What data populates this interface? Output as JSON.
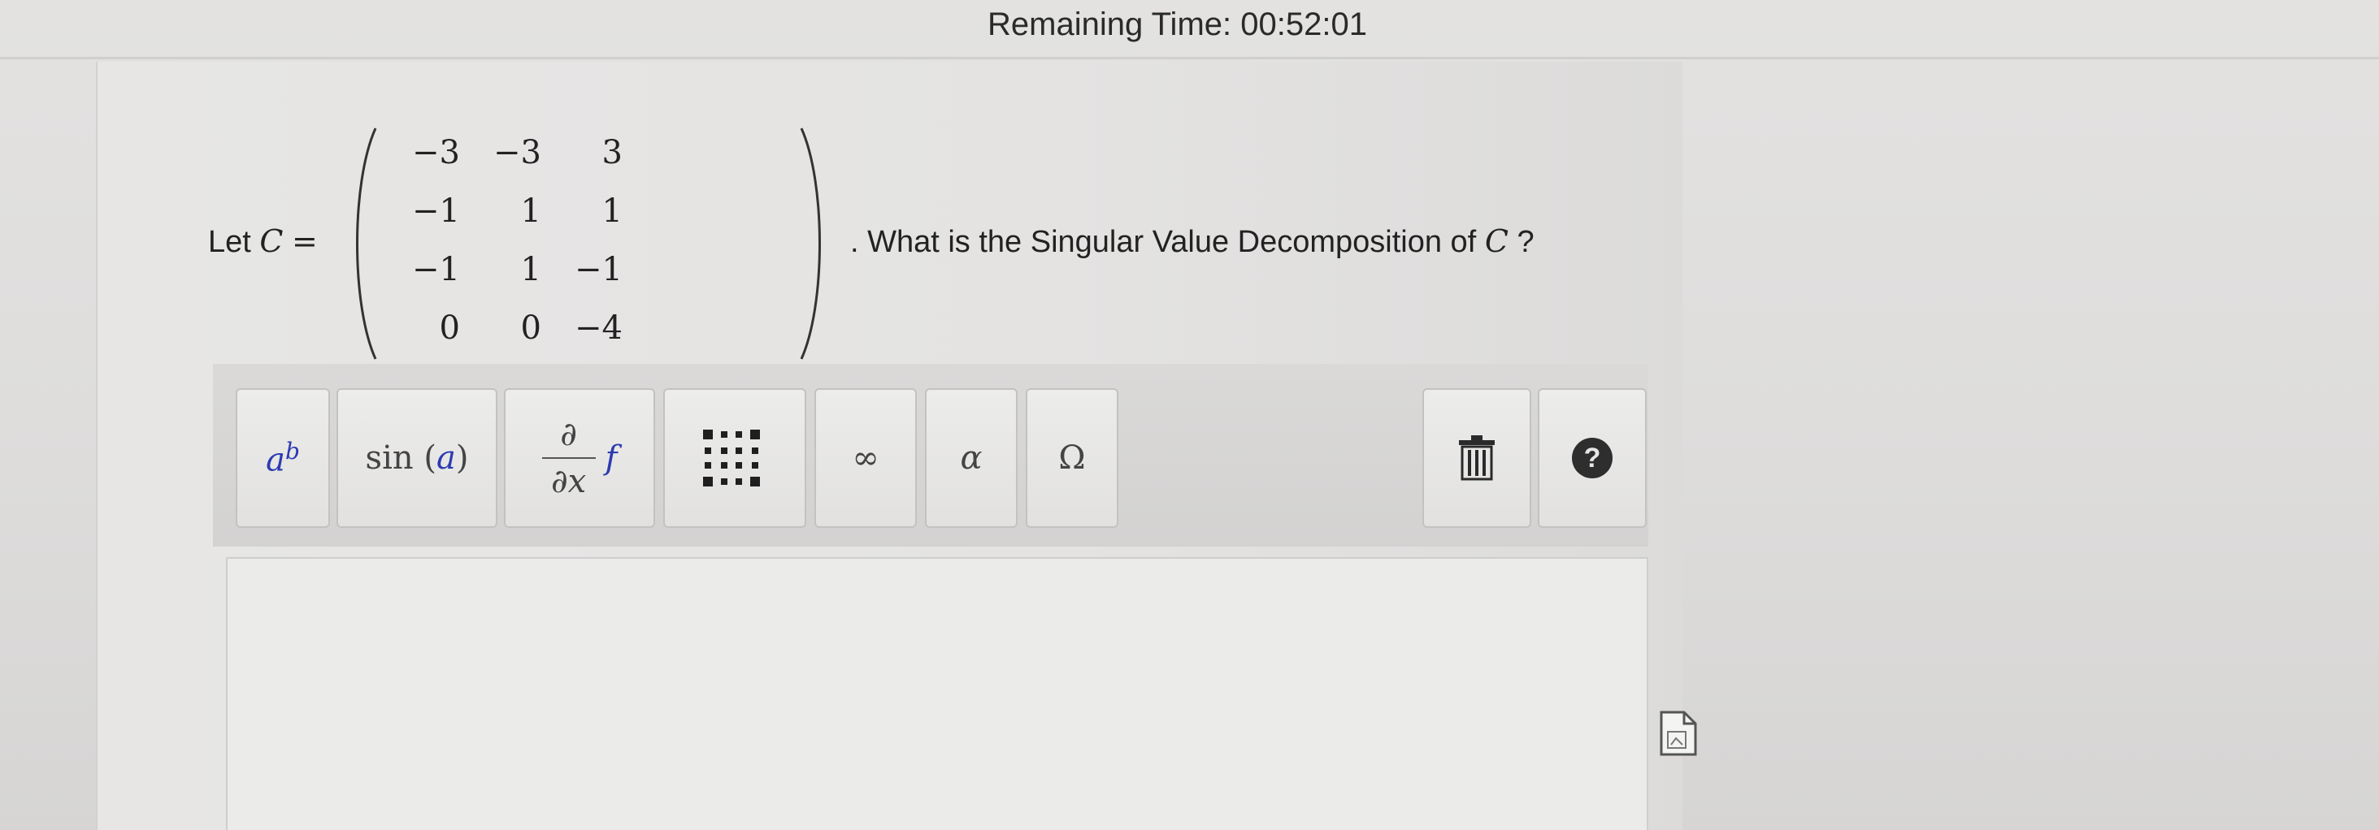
{
  "header": {
    "timer_text": "Remaining Time: 00:52:01"
  },
  "question": {
    "prefix": "Let",
    "variable": "C",
    "equals": "=",
    "matrix": [
      [
        "−3",
        "−3",
        "3"
      ],
      [
        "−1",
        "1",
        "1"
      ],
      [
        "−1",
        "1",
        "−1"
      ],
      [
        "0",
        "0",
        "−4"
      ]
    ],
    "suffix": ". What is the Singular Value Decomposition of",
    "suffix_variable": "C",
    "suffix_end": " ?"
  },
  "toolbar": {
    "buttons": [
      {
        "name": "exponent",
        "base": "a",
        "sup": "b"
      },
      {
        "name": "function",
        "label": "sin",
        "arg": "a"
      },
      {
        "name": "derivative",
        "num": "∂",
        "den": "∂x",
        "fn": "f"
      },
      {
        "name": "matrix",
        "icon": "matrix-grid-icon"
      },
      {
        "name": "infinity",
        "label": "∞"
      },
      {
        "name": "greek-lower",
        "label": "α"
      },
      {
        "name": "greek-upper",
        "label": "Ω"
      },
      {
        "name": "clear",
        "icon": "trash-icon"
      },
      {
        "name": "help",
        "label": "?"
      }
    ]
  },
  "answer": {
    "value": ""
  },
  "icons": {
    "side": "document-icon"
  },
  "colors": {
    "accent_blue": "#2c3bb0"
  }
}
